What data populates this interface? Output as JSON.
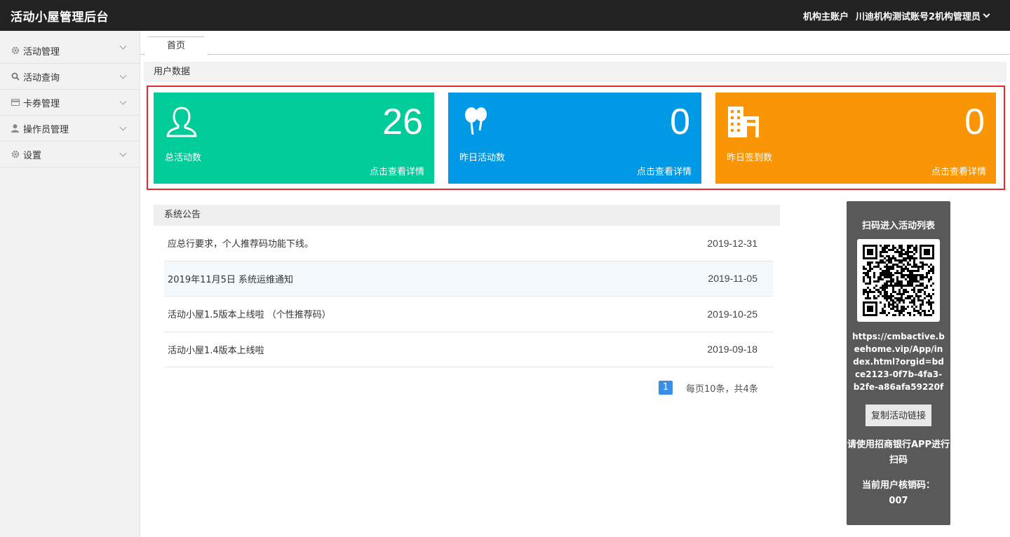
{
  "header": {
    "brand": "活动小屋管理后台",
    "account_type": "机构主账户",
    "account_name": "川迪机构测试账号2机构管理员"
  },
  "sidebar": {
    "items": [
      {
        "label": "活动管理",
        "icon": "gear-icon"
      },
      {
        "label": "活动查询",
        "icon": "search-icon"
      },
      {
        "label": "卡券管理",
        "icon": "card-icon"
      },
      {
        "label": "操作员管理",
        "icon": "user-icon"
      },
      {
        "label": "设置",
        "icon": "gear-icon"
      }
    ]
  },
  "tabs": [
    {
      "label": "首页"
    }
  ],
  "user_data": {
    "title": "用户数据",
    "cards": [
      {
        "value": "26",
        "label": "总活动数",
        "link": "点击查看详情",
        "color": "#00cc99",
        "icon": "user-outline-icon"
      },
      {
        "value": "0",
        "label": "昨日活动数",
        "link": "点击查看详情",
        "color": "#0099e5",
        "icon": "balloons-icon"
      },
      {
        "value": "0",
        "label": "昨日签到数",
        "link": "点击查看详情",
        "color": "#fa9505",
        "icon": "building-icon"
      }
    ]
  },
  "notices": {
    "title": "系统公告",
    "rows": [
      {
        "text": "应总行要求，个人推荐码功能下线。",
        "date": "2019-12-31"
      },
      {
        "text": "2019年11月5日 系统运维通知",
        "date": "2019-11-05"
      },
      {
        "text": "活动小屋1.5版本上线啦 （个性推荐码）",
        "date": "2019-10-25"
      },
      {
        "text": "活动小屋1.4版本上线啦",
        "date": "2019-09-18"
      }
    ],
    "pager": {
      "current": "1",
      "summary": "每页10条，共4条"
    }
  },
  "qr_panel": {
    "title": "扫码进入活动列表",
    "url": "https://cmbactive.beehome.vip/App/index.html?orgid=bdce2123-0f7b-4fa3-b2fe-a86afa59220f",
    "copy_label": "复制活动链接",
    "hint": "请使用招商银行APP进行扫码",
    "code_label": "当前用户核销码：",
    "code_value": "007"
  }
}
